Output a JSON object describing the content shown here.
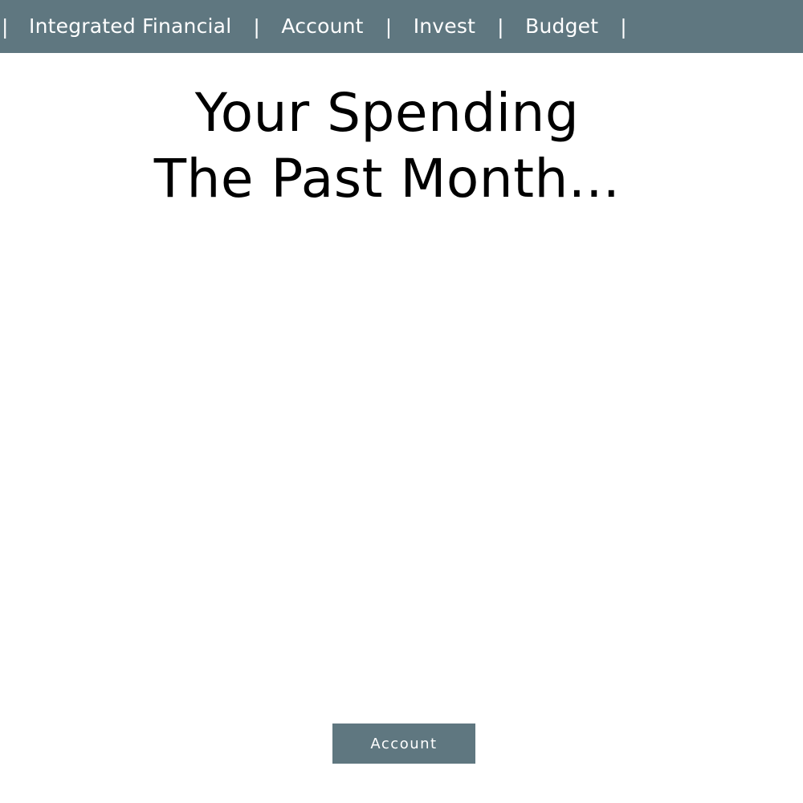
{
  "nav": {
    "separator": "|",
    "items": [
      {
        "label": "Integrated Financial"
      },
      {
        "label": "Account"
      },
      {
        "label": "Invest"
      },
      {
        "label": "Budget"
      }
    ]
  },
  "headline": {
    "line1": "Your Spending",
    "line2": "The Past Month..."
  },
  "cta": {
    "label": "Account"
  },
  "colors": {
    "nav_background": "#5f7780",
    "button_background": "#5f7780",
    "text_primary": "#000000",
    "text_inverse": "#ffffff"
  }
}
